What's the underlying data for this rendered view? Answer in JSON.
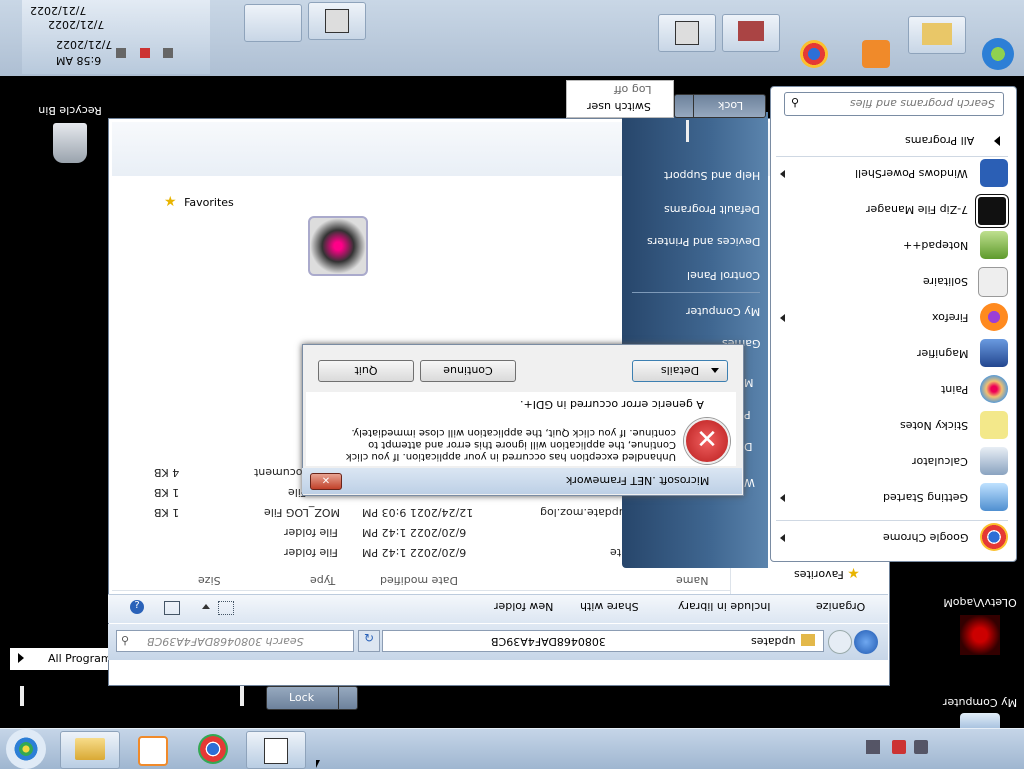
{
  "ghost_taskbar": {
    "clock_time": "6:58 AM",
    "clock_date": "7/21/2022",
    "clock_date_ghost_1": "7/21/2022",
    "clock_date_ghost_2": "7/21/2022"
  },
  "desktop": {
    "recycle_bin_label": "Recycle Bin",
    "my_computer_label": "My Computer",
    "user_folder_label": "OLetvV\\aqoM",
    "all_programs_ghost_label": "All Programs",
    "lock_ghost_label": "Lock"
  },
  "start_menu": {
    "search_placeholder": "Search programs and files",
    "all_programs_label": "All Programs",
    "items": [
      {
        "label": "Google Chrome",
        "icon": "chrome-icon",
        "color": "#f4c20d"
      },
      {
        "label": "Getting Started",
        "icon": "getting-started-icon",
        "color": "#6fa8dc"
      },
      {
        "label": "Calculator",
        "icon": "calculator-icon",
        "color": "#9fb3c8"
      },
      {
        "label": "Sticky Notes",
        "icon": "sticky-notes-icon",
        "color": "#f3e88a"
      },
      {
        "label": "Paint",
        "icon": "paint-icon",
        "color": "#e8b27a"
      },
      {
        "label": "Magnifier",
        "icon": "magnifier-icon",
        "color": "#4b78b5"
      },
      {
        "label": "Firefox",
        "icon": "firefox-icon",
        "color": "#e8662b"
      },
      {
        "label": "Solitaire",
        "icon": "solitaire-icon",
        "color": "#e6e6e6"
      },
      {
        "label": "Notepad++",
        "icon": "notepad-plus-plus-icon",
        "color": "#8bbf5a"
      },
      {
        "label": "7-Zip File Manager",
        "icon": "seven-zip-icon",
        "color": "#111111"
      },
      {
        "label": "Windows PowerShell",
        "icon": "powershell-icon",
        "color": "#2b5fb5"
      }
    ],
    "right_links": [
      "Help and Support",
      "Default Programs",
      "Devices and Printers",
      "Control Panel",
      "My Computer",
      "Games"
    ],
    "lock_label": "Lock",
    "switch_user_label": "Switch user",
    "log_off_label": "Log off"
  },
  "explorer": {
    "address_path": [
      "3080468DAF4A39CB",
      "updates"
    ],
    "search_placeholder": "Search 3080468DAF4A39CB",
    "toolbar": {
      "organize": "Organize",
      "include_in_library": "Include in library",
      "share_with": "Share with",
      "new_folder": "New folder"
    },
    "favorites_label": "Favorites",
    "nav_favorites_label": "Favorites",
    "columns": [
      "Name",
      "Date modified",
      "Type",
      "Size"
    ],
    "rows": [
      {
        "name": "update",
        "date": "6/20/2022 1:42 PM",
        "type": "File folder",
        "size": ""
      },
      {
        "name": "",
        "date": "6/20/2022 1:42 PM",
        "type": "File folder",
        "size": ""
      },
      {
        "name": "update.moz.log",
        "date": "12/24/2021 9:03 PM",
        "type": "MOZ_LOG File",
        "size": "1 KB"
      },
      {
        "name": "",
        "date": "",
        "type": "File",
        "size": "1 KB"
      },
      {
        "name": "",
        "date": "",
        "type": "Document",
        "size": "4 KB"
      }
    ]
  },
  "dialog": {
    "title": "Microsoft .NET Framework",
    "message": "Unhandled exception has occurred in your application. If you click Continue, the application will ignore this error and attempt to continue. If you click Quit, the application will close immediately.",
    "detail": "A generic error occurred in GDI+.",
    "details_btn": "Details",
    "continue_btn": "Continue",
    "quit_btn": "Quit"
  },
  "side_labels": [
    "M",
    "P",
    "D",
    "W"
  ]
}
